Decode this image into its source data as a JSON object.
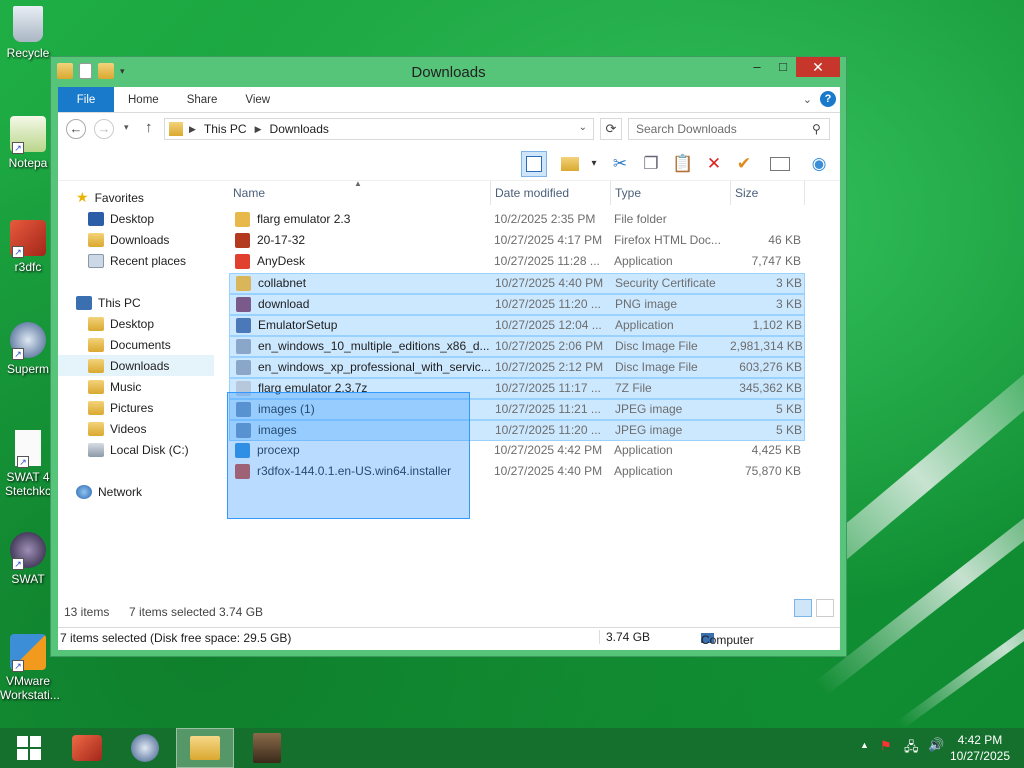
{
  "desktop": {
    "icons": [
      {
        "label": "Recycle",
        "name": "recycle-bin"
      },
      {
        "label": "Notepa",
        "name": "notepad"
      },
      {
        "label": "r3dfc",
        "name": "r3dfox"
      },
      {
        "label": "Superm",
        "name": "superm"
      },
      {
        "label": "SWAT 4 Stetchkc",
        "name": "swat4-stetchkov"
      },
      {
        "label": "SWAT",
        "name": "swat"
      },
      {
        "label": "VMware Workstati...",
        "name": "vmware-workstation"
      }
    ]
  },
  "window": {
    "title": "Downloads",
    "minimize": "–",
    "maximize": "□",
    "close": "✕"
  },
  "ribbon": {
    "tabs": [
      "File",
      "Home",
      "Share",
      "View"
    ]
  },
  "address": {
    "crumbs": [
      "This PC",
      "Downloads"
    ],
    "search_placeholder": "Search Downloads"
  },
  "navpane": {
    "favorites": "Favorites",
    "fav_items": [
      "Desktop",
      "Downloads",
      "Recent places"
    ],
    "thispc": "This PC",
    "pc_items": [
      "Desktop",
      "Documents",
      "Downloads",
      "Music",
      "Pictures",
      "Videos",
      "Local Disk (C:)"
    ],
    "network": "Network"
  },
  "columns": {
    "name": "Name",
    "date": "Date modified",
    "type": "Type",
    "size": "Size"
  },
  "files": [
    {
      "name": "flarg emulator 2.3",
      "date": "10/2/2025 2:35 PM",
      "type": "File folder",
      "size": "",
      "selected": false,
      "icon": "#e8b84a"
    },
    {
      "name": "20-17-32",
      "date": "10/27/2025 4:17 PM",
      "type": "Firefox HTML Doc...",
      "size": "46 KB",
      "selected": false,
      "icon": "#b33a1f"
    },
    {
      "name": "AnyDesk",
      "date": "10/27/2025 11:28 ...",
      "type": "Application",
      "size": "7,747 KB",
      "selected": false,
      "icon": "#e2402f"
    },
    {
      "name": "collabnet",
      "date": "10/27/2025 4:40 PM",
      "type": "Security Certificate",
      "size": "3 KB",
      "selected": true,
      "icon": "#d9b65a"
    },
    {
      "name": "download",
      "date": "10/27/2025 11:20 ...",
      "type": "PNG image",
      "size": "3 KB",
      "selected": true,
      "icon": "#7a5a8a"
    },
    {
      "name": "EmulatorSetup",
      "date": "10/27/2025 12:04 ...",
      "type": "Application",
      "size": "1,102 KB",
      "selected": true,
      "icon": "#4a78b8"
    },
    {
      "name": "en_windows_10_multiple_editions_x86_d...",
      "date": "10/27/2025 2:06 PM",
      "type": "Disc Image File",
      "size": "2,981,314 KB",
      "selected": true,
      "icon": "#8aa6c8"
    },
    {
      "name": "en_windows_xp_professional_with_servic...",
      "date": "10/27/2025 2:12 PM",
      "type": "Disc Image File",
      "size": "603,276 KB",
      "selected": true,
      "icon": "#8aa6c8"
    },
    {
      "name": "flarg emulator 2.3.7z",
      "date": "10/27/2025 11:17 ...",
      "type": "7Z File",
      "size": "345,362 KB",
      "selected": true,
      "icon": "#b8c8dc"
    },
    {
      "name": "images (1)",
      "date": "10/27/2025 11:21 ...",
      "type": "JPEG image",
      "size": "5 KB",
      "selected": true,
      "icon": "#6d8fb8"
    },
    {
      "name": "images",
      "date": "10/27/2025 11:20 ...",
      "type": "JPEG image",
      "size": "5 KB",
      "selected": true,
      "icon": "#6d8fb8"
    },
    {
      "name": "procexp",
      "date": "10/27/2025 4:42 PM",
      "type": "Application",
      "size": "4,425 KB",
      "selected": false,
      "icon": "#2d8ad6"
    },
    {
      "name": "r3dfox-144.0.1.en-US.win64.installer",
      "date": "10/27/2025 4:40 PM",
      "type": "Application",
      "size": "75,870 KB",
      "selected": false,
      "icon": "#d8462e"
    }
  ],
  "status": {
    "items": "13 items",
    "selected": "7 items selected",
    "selected_size": "3.74 GB"
  },
  "bottombar": {
    "info": "7 items selected (Disk free space: 29.5 GB)",
    "size": "3.74 GB",
    "location": "Computer"
  },
  "taskbar": {
    "time": "4:42 PM",
    "date": "10/27/2025"
  }
}
